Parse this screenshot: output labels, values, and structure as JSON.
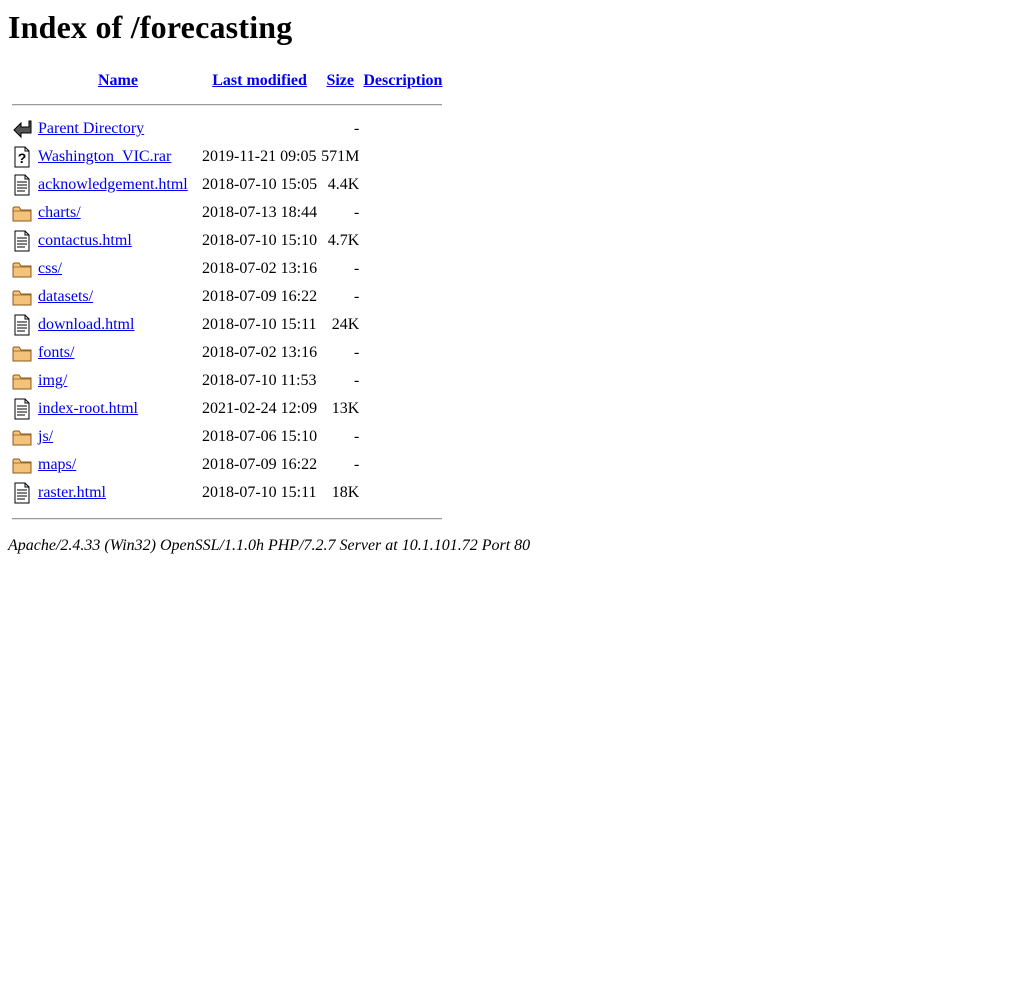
{
  "page": {
    "title": "Index of /forecasting"
  },
  "columns": {
    "name": "Name",
    "last_modified": "Last modified",
    "size": "Size",
    "description": "Description"
  },
  "entries": [
    {
      "name": "Parent Directory",
      "modified": "",
      "size": "-",
      "icon": "back-arrow-icon"
    },
    {
      "name": "Washington_VIC.rar",
      "modified": "2019-11-21 09:05",
      "size": "571M",
      "icon": "unknown-file-icon"
    },
    {
      "name": "acknowledgement.html",
      "modified": "2018-07-10 15:05",
      "size": "4.4K",
      "icon": "text-file-icon"
    },
    {
      "name": "charts/",
      "modified": "2018-07-13 18:44",
      "size": "-",
      "icon": "folder-icon"
    },
    {
      "name": "contactus.html",
      "modified": "2018-07-10 15:10",
      "size": "4.7K",
      "icon": "text-file-icon"
    },
    {
      "name": "css/",
      "modified": "2018-07-02 13:16",
      "size": "-",
      "icon": "folder-icon"
    },
    {
      "name": "datasets/",
      "modified": "2018-07-09 16:22",
      "size": "-",
      "icon": "folder-icon"
    },
    {
      "name": "download.html",
      "modified": "2018-07-10 15:11",
      "size": "24K",
      "icon": "text-file-icon"
    },
    {
      "name": "fonts/",
      "modified": "2018-07-02 13:16",
      "size": "-",
      "icon": "folder-icon"
    },
    {
      "name": "img/",
      "modified": "2018-07-10 11:53",
      "size": "-",
      "icon": "folder-icon"
    },
    {
      "name": "index-root.html",
      "modified": "2021-02-24 12:09",
      "size": "13K",
      "icon": "text-file-icon"
    },
    {
      "name": "js/",
      "modified": "2018-07-06 15:10",
      "size": "-",
      "icon": "folder-icon"
    },
    {
      "name": "maps/",
      "modified": "2018-07-09 16:22",
      "size": "-",
      "icon": "folder-icon"
    },
    {
      "name": "raster.html",
      "modified": "2018-07-10 15:11",
      "size": "18K",
      "icon": "text-file-icon"
    }
  ],
  "footer": {
    "server_signature": "Apache/2.4.33 (Win32) OpenSSL/1.1.0h PHP/7.2.7 Server at 10.1.101.72 Port 80"
  },
  "colors": {
    "link": "#0000ee",
    "folder_fill": "#f4c27a",
    "folder_stroke": "#8a5a1a"
  }
}
